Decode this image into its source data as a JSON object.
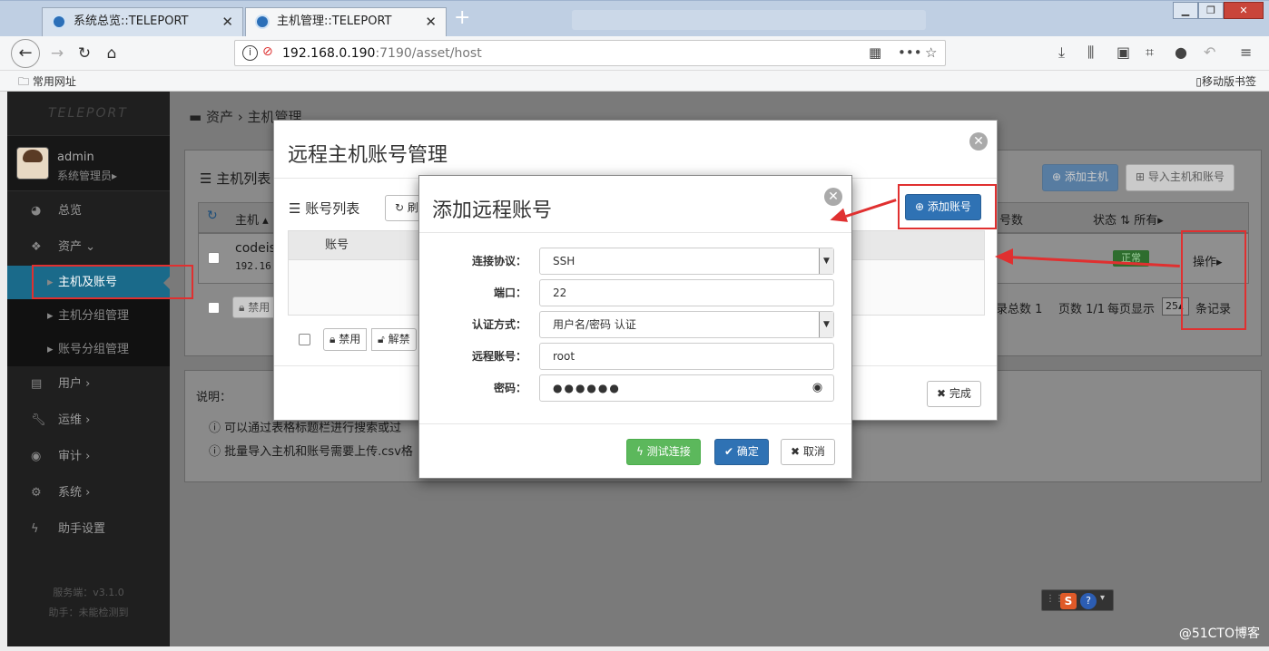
{
  "browser": {
    "tabs": [
      {
        "title": "系统总览::TELEPORT"
      },
      {
        "title": "主机管理::TELEPORT"
      }
    ],
    "url_host": "192.168.0.190",
    "url_path": ":7190/asset/host",
    "bookmarks_left": "常用网址",
    "bookmarks_right": "移动版书签"
  },
  "sidebar": {
    "logo": "TELEPORT",
    "user_name": "admin",
    "user_role": "系统管理员",
    "menu": [
      {
        "label": "总览"
      },
      {
        "label": "资产"
      },
      {
        "label": "主机及账号"
      },
      {
        "label": "主机分组管理"
      },
      {
        "label": "账号分组管理"
      },
      {
        "label": "用户"
      },
      {
        "label": "运维"
      },
      {
        "label": "审计"
      },
      {
        "label": "系统"
      },
      {
        "label": "助手设置"
      }
    ],
    "server_version": "服务端：v3.1.0",
    "assistant_status": "助手：未能检测到"
  },
  "page": {
    "breadcrumb_root": "资产",
    "breadcrumb_current": "主机管理",
    "host_list_title": "主机列表",
    "add_host": "添加主机",
    "import_hosts": "导入主机和账号",
    "col_host": "主机",
    "col_account_count": "号数",
    "col_status": "状态",
    "status_filter": "所有",
    "row_host_name": "codeis",
    "row_host_ip": "192.16",
    "row_status": "正常",
    "row_action": "操作",
    "disable": "禁用",
    "pager_total": "录总数 1",
    "pager_pages": "页数 1/1",
    "pager_per_page": "每页显示",
    "pager_size": "25",
    "pager_records": "条记录",
    "notes_title": "说明：",
    "note1": "可以通过表格标题栏进行搜索或过",
    "note2": "批量导入主机和账号需要上传.csv格"
  },
  "modal_accounts": {
    "title": "远程主机账号管理",
    "list_title": "账号列表",
    "refresh": "刷",
    "add_account": "添加账号",
    "col_account": "账号",
    "disable": "禁用",
    "unlock": "解禁",
    "done": "完成"
  },
  "modal_add": {
    "title": "添加远程账号",
    "fields": {
      "protocol_label": "连接协议：",
      "protocol_value": "SSH",
      "port_label": "端口：",
      "port_value": "22",
      "auth_label": "认证方式：",
      "auth_value": "用户名/密码 认证",
      "account_label": "远程账号：",
      "account_value": "root",
      "password_label": "密码：",
      "password_value": "●●●●●●"
    },
    "test_btn": "测试连接",
    "ok_btn": "确定",
    "cancel_btn": "取消"
  },
  "watermark": "@51CTO博客",
  "colors": {
    "primary": "#2f72b4",
    "success": "#5cb85c",
    "annotation": "#e03030",
    "sidebar_bg": "#1f1f1f"
  }
}
